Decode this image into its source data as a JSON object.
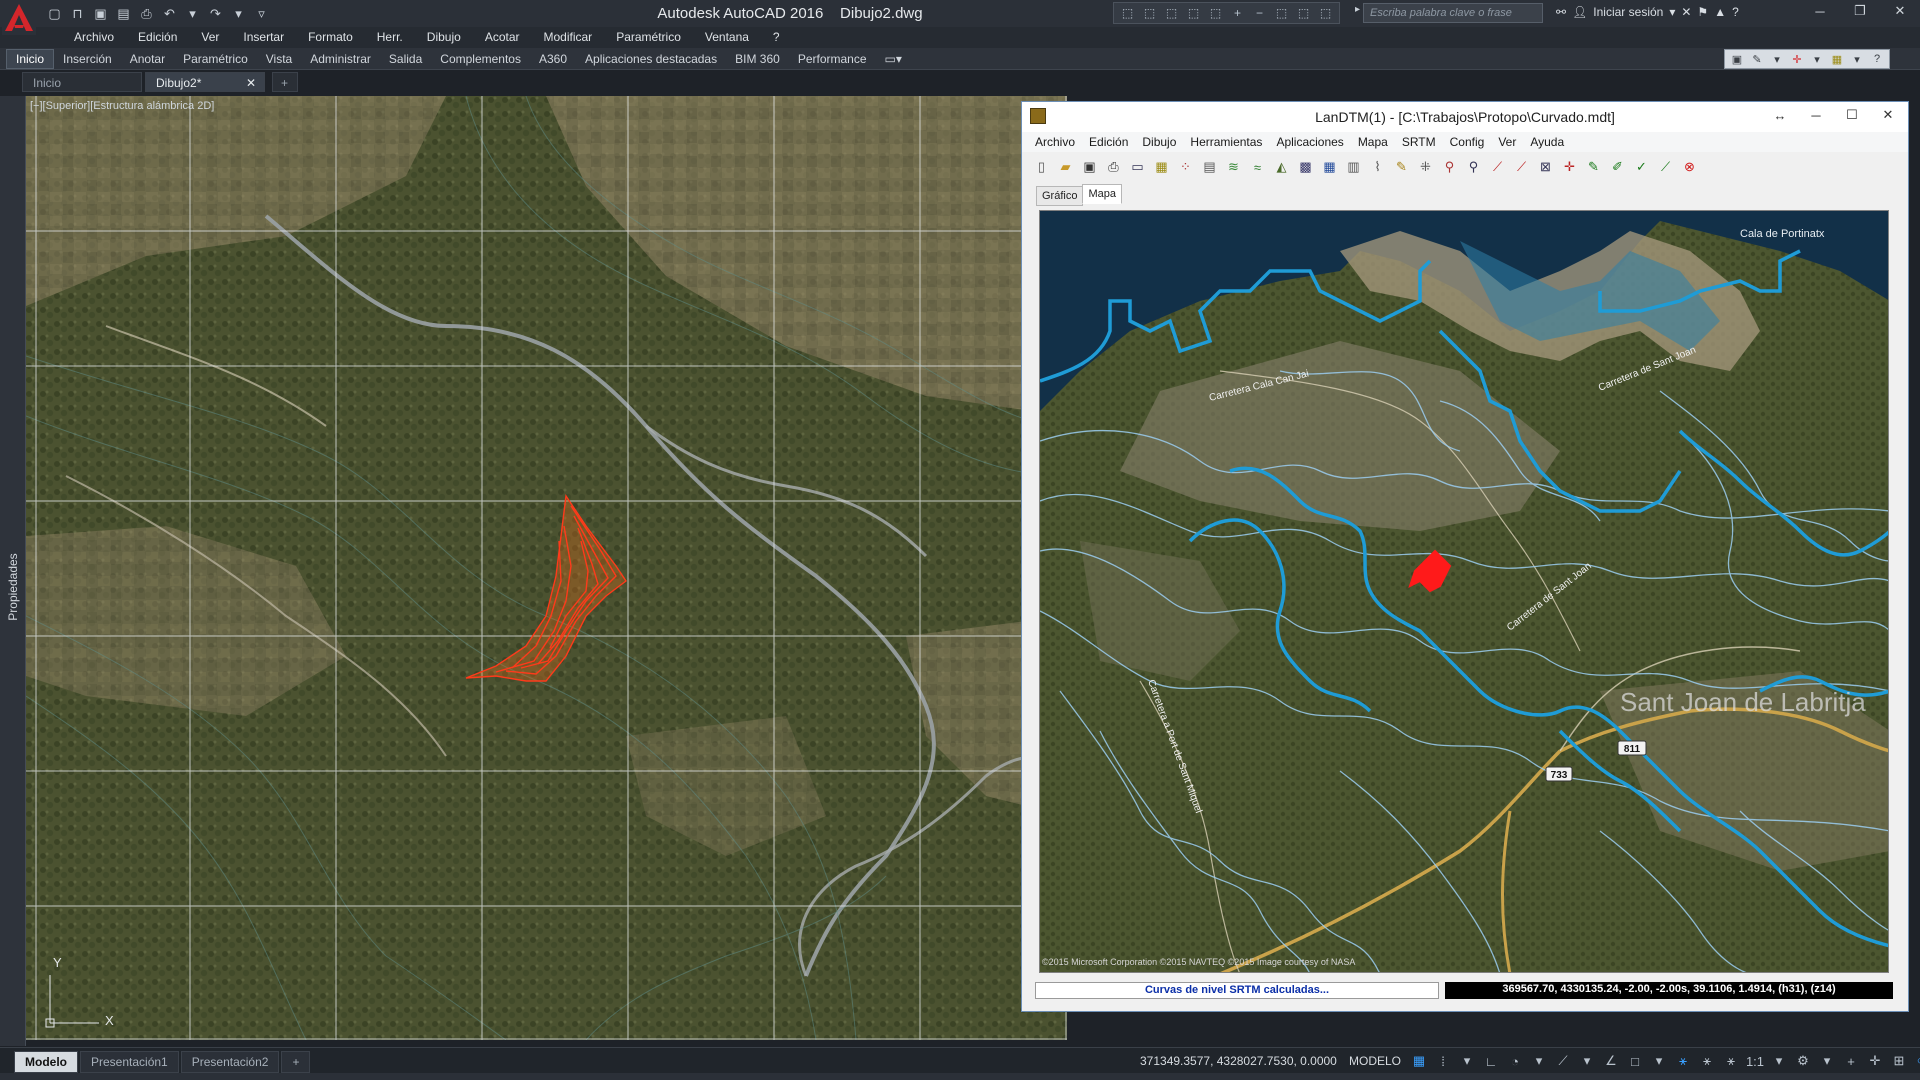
{
  "app": {
    "title": "Autodesk AutoCAD 2016",
    "file": "Dibujo2.dwg",
    "search_placeholder": "Escriba palabra clave o frase",
    "signin": "Iniciar sesión"
  },
  "menu": [
    "Archivo",
    "Edición",
    "Ver",
    "Insertar",
    "Formato",
    "Herr.",
    "Dibujo",
    "Acotar",
    "Modificar",
    "Paramétrico",
    "Ventana",
    "?"
  ],
  "ribbon_tabs": [
    "Inicio",
    "Inserción",
    "Anotar",
    "Paramétrico",
    "Vista",
    "Administrar",
    "Salida",
    "Complementos",
    "A360",
    "Aplicaciones destacadas",
    "BIM 360",
    "Performance"
  ],
  "doc_tabs": {
    "start": "Inicio",
    "current": "Dibujo2*",
    "add": "+"
  },
  "sidebar": {
    "properties": "Propiedades"
  },
  "viewport": {
    "label": "[−][Superior][Estructura alámbrica 2D]"
  },
  "ucs": {
    "x": "X",
    "y": "Y"
  },
  "landtm": {
    "title": "LanDTM(1) - [C:\\Trabajos\\Protopo\\Curvado.mdt]",
    "menu": [
      "Archivo",
      "Edición",
      "Dibujo",
      "Herramientas",
      "Aplicaciones",
      "Mapa",
      "SRTM",
      "Config",
      "Ver",
      "Ayuda"
    ],
    "tabs": [
      "Gráfico",
      "Mapa"
    ],
    "active_tab": "Mapa",
    "map_labels": {
      "road1": "Carretera Cala Can Jai",
      "road2": "Carretera de Sant Joan",
      "road3": "Carretera de Sant Joan",
      "road4": "Carretera a Port de Sant Miquel",
      "place1": "Cala de Portinatx",
      "town": "Sant Joan de Labritja",
      "route1": "811",
      "route2": "733"
    },
    "credit": "©2015 Microsoft Corporation ©2015 NAVTEQ ©2015 Image courtesy of NASA",
    "status_left": "Curvas de nivel SRTM calculadas...",
    "status_right": "369567.70, 4330135.24, -2.00, -2.00s, 39.1106, 1.4914, (h31), (z14)"
  },
  "layouts": [
    "Modelo",
    "Presentación1",
    "Presentación2",
    "+"
  ],
  "status": {
    "coords": "371349.3577, 4328027.7530, 0.0000",
    "space": "MODELO",
    "scale": "1:1"
  },
  "colors": {
    "contour_blue": "#4fb0e6",
    "contour_light": "#9bcdf0",
    "highlight_red": "#ff2a1a",
    "road_gold": "#c9a24a"
  }
}
